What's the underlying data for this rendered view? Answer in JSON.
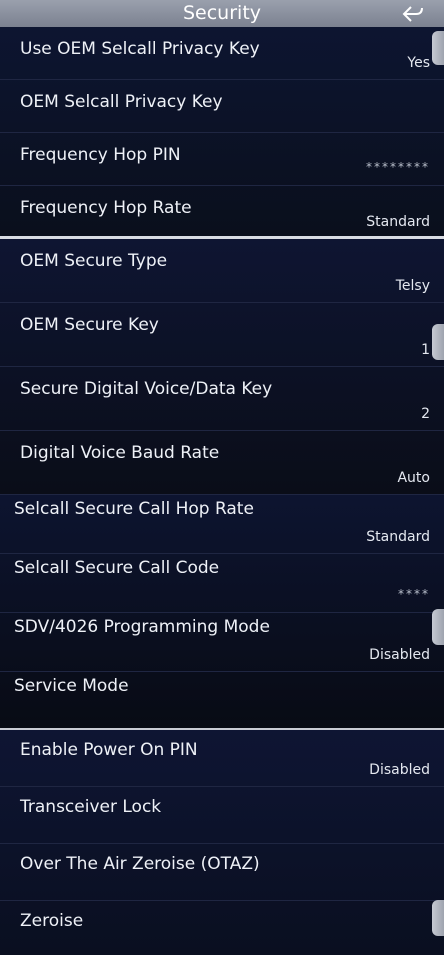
{
  "header": {
    "title": "Security",
    "back_icon": "back-arrow-icon"
  },
  "panels": [
    {
      "rows": [
        {
          "label": "Use OEM Selcall Privacy Key",
          "value": "Yes"
        },
        {
          "label": "OEM Selcall Privacy Key",
          "value": ""
        },
        {
          "label": "Frequency Hop PIN",
          "value": "********"
        },
        {
          "label": "Frequency Hop Rate",
          "value": "Standard"
        }
      ]
    },
    {
      "rows": [
        {
          "label": "OEM Secure Type",
          "value": "Telsy"
        },
        {
          "label": "OEM Secure Key",
          "value": "1"
        },
        {
          "label": "Secure Digital Voice/Data Key",
          "value": "2"
        },
        {
          "label": "Digital Voice Baud Rate",
          "value": "Auto"
        }
      ]
    },
    {
      "rows": [
        {
          "label": "Selcall Secure Call Hop Rate",
          "value": "Standard"
        },
        {
          "label": "Selcall Secure Call Code",
          "value": "****"
        },
        {
          "label": "SDV/4026 Programming Mode",
          "value": "Disabled"
        },
        {
          "label": "Service Mode",
          "value": ""
        }
      ]
    },
    {
      "rows": [
        {
          "label": "Enable Power On PIN",
          "value": "Disabled"
        },
        {
          "label": "Transceiver Lock",
          "value": ""
        },
        {
          "label": "Over The Air Zeroise (OTAZ)",
          "value": ""
        },
        {
          "label": "Zeroise",
          "value": ""
        }
      ]
    }
  ],
  "colors": {
    "header": "#8a909c",
    "background": "#0b0f1e",
    "text": "#eef1f7"
  }
}
